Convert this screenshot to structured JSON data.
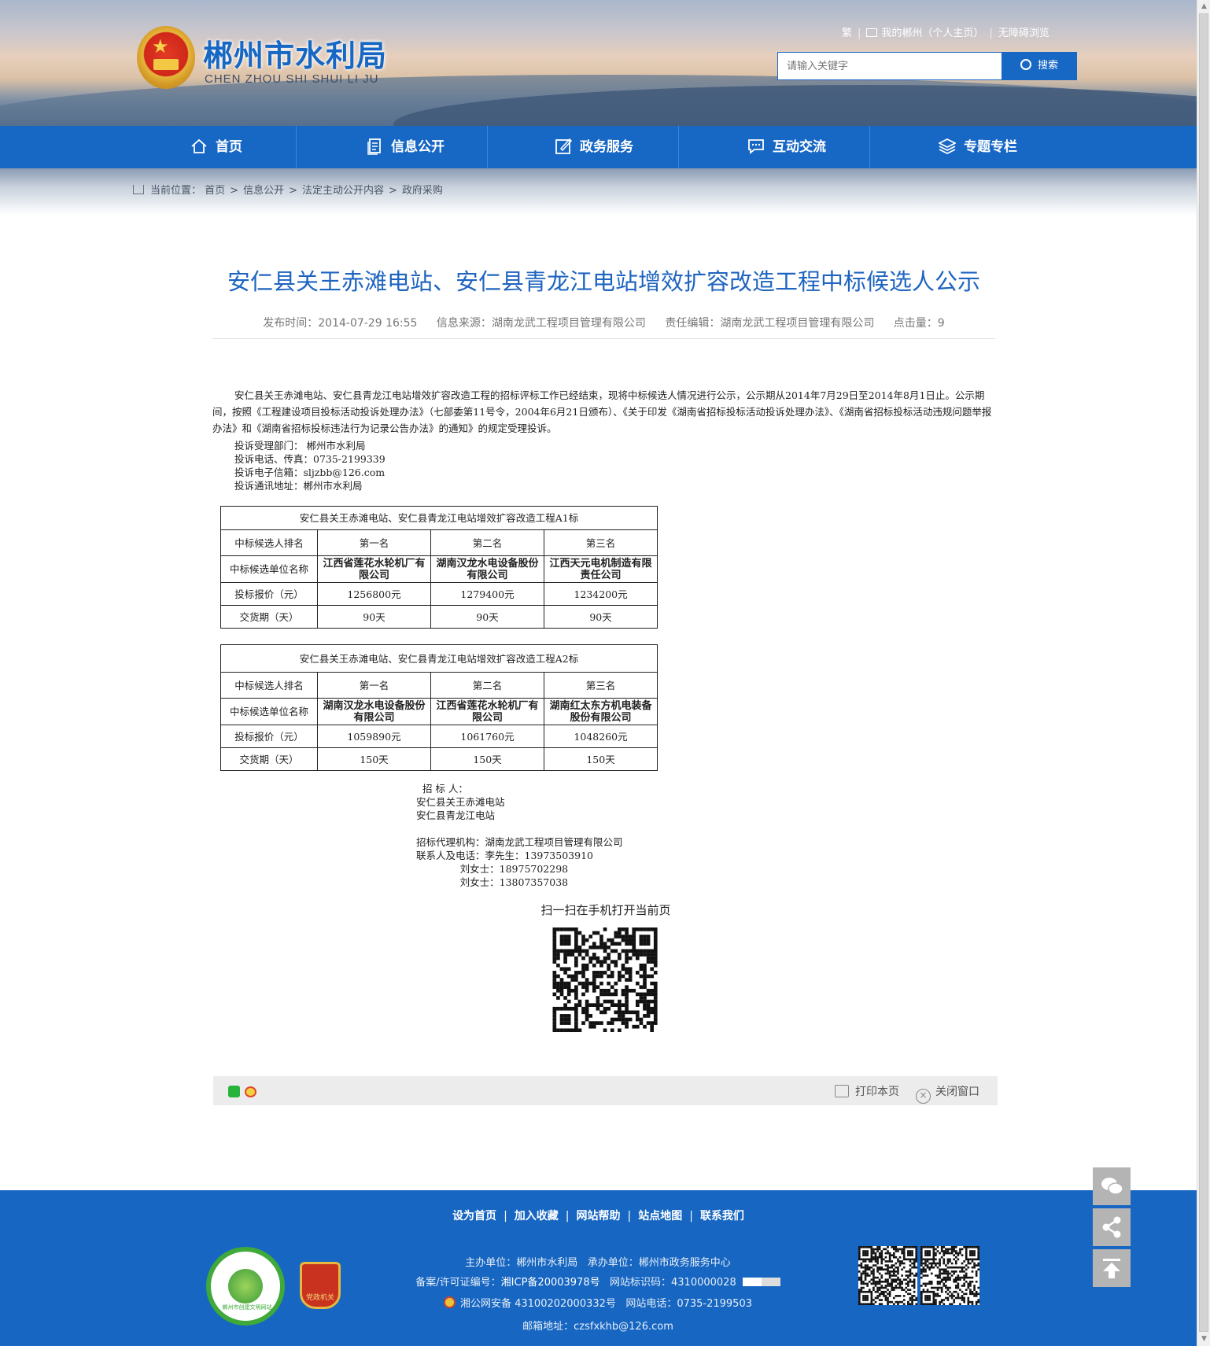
{
  "header": {
    "site_title": "郴州市水利局",
    "site_subtitle": "CHEN ZHOU SHI SHUI LI JU",
    "top_links": {
      "traditional": "繁",
      "my_chenzhou": "我的郴州（个人主页）",
      "accessible": "无障碍浏览"
    },
    "search": {
      "placeholder": "请输入关键字",
      "button_label": "搜索"
    }
  },
  "nav": {
    "items": [
      {
        "label": "首页",
        "icon": "home-icon"
      },
      {
        "label": "信息公开",
        "icon": "document-icon"
      },
      {
        "label": "政务服务",
        "icon": "edit-icon"
      },
      {
        "label": "互动交流",
        "icon": "chat-icon"
      },
      {
        "label": "专题专栏",
        "icon": "layers-icon"
      }
    ]
  },
  "breadcrumb": {
    "prefix": "当前位置：",
    "items": [
      "首页",
      "信息公开",
      "法定主动公开内容",
      "政府采购"
    ],
    "separator": ">"
  },
  "article": {
    "title": "安仁县关王赤滩电站、安仁县青龙江电站增效扩容改造工程中标候选人公示",
    "published": "发布时间：2014-07-29 16:55",
    "source": "信息来源：湖南龙武工程项目管理有限公司",
    "editor": "责任编辑：湖南龙武工程项目管理有限公司",
    "hits": "点击量：9",
    "intro": "安仁县关王赤滩电站、安仁县青龙江电站增效扩容改造工程的招标评标工作已经结束，现将中标候选人情况进行公示，公示期从2014年7月29日至2014年8月1日止。公示期间，按照《工程建设项目投标活动投诉处理办法》（七部委第11号令，2004年6月21日颁布）、《关于印发《湖南省招标投标活动投诉处理办法》、《湖南省招标投标活动违规问题举报办法》和《湖南省招标投标违法行为记录公告办法》的通知》的规定受理投诉。",
    "contact": [
      "投诉受理部门： 郴州市水利局",
      "投诉电话、传真：0735-2199339",
      "投诉电子信箱：sljzbb@126.com",
      "投诉通讯地址：郴州市水利局"
    ],
    "tables": [
      {
        "caption": "安仁县关王赤滩电站、安仁县青龙江电站增效扩容改造工程A1标",
        "row_labels": [
          "中标候选人排名",
          "中标候选单位名称",
          "投标报价（元）",
          "交货期（天）"
        ],
        "ranks": [
          "第一名",
          "第二名",
          "第三名"
        ],
        "companies": [
          "江西省莲花水轮机厂有限公司",
          "湖南汉龙水电设备股份有限公司",
          "江西天元电机制造有限责任公司"
        ],
        "prices": [
          "1256800元",
          "1279400元",
          "1234200元"
        ],
        "delivery": [
          "90天",
          "90天",
          "90天"
        ]
      },
      {
        "caption": "安仁县关王赤滩电站、安仁县青龙江电站增效扩容改造工程A2标",
        "row_labels": [
          "中标候选人排名",
          "中标候选单位名称",
          "投标报价（元）",
          "交货期（天）"
        ],
        "ranks": [
          "第一名",
          "第二名",
          "第三名"
        ],
        "companies": [
          "湖南汉龙水电设备股份有限公司",
          "江西省莲花水轮机厂有限公司",
          "湖南红太东方机电装备股份有限公司"
        ],
        "prices": [
          "1059890元",
          "1061760元",
          "1048260元"
        ],
        "delivery": [
          "150天",
          "150天",
          "150天"
        ]
      }
    ],
    "signoff": "  招 标 人：\n安仁县关王赤滩电站\n安仁县青龙江电站\n\n招标代理机构：湖南龙武工程项目管理有限公司\n联系人及电话：李先生：13973503910\n              刘女士：18975702298\n              刘女士：13807357038",
    "qr_caption": "扫一扫在手机打开当前页"
  },
  "share_bar": {
    "print_label": "打印本页",
    "close_label": "关闭窗口"
  },
  "footer": {
    "links": [
      "设为首页",
      "加入收藏",
      "网站帮助",
      "站点地图",
      "联系我们"
    ],
    "sponsor": "主办单位：郴州市水利局",
    "organizer": "承办单位：郴州市政务服务中心",
    "icp_prefix": "备案/许可证编号：",
    "icp": "湘ICP备20003978号",
    "site_id": "网站标识码：4310000028",
    "police": "湘公网安备 43100202000332号",
    "phone": "网站电话：0735-2199503",
    "email": "邮箱地址：czsfxkhb@126.com",
    "badge_red_text": "党政机关",
    "badge_green_text": "郴州市创建文明网站"
  },
  "side_tools": [
    "wechat-icon",
    "share-icon",
    "back-to-top-icon"
  ],
  "colors": {
    "brand_blue": "#1767c4",
    "footer_blue": "#1666c2",
    "title_blue": "#1e64c0"
  }
}
